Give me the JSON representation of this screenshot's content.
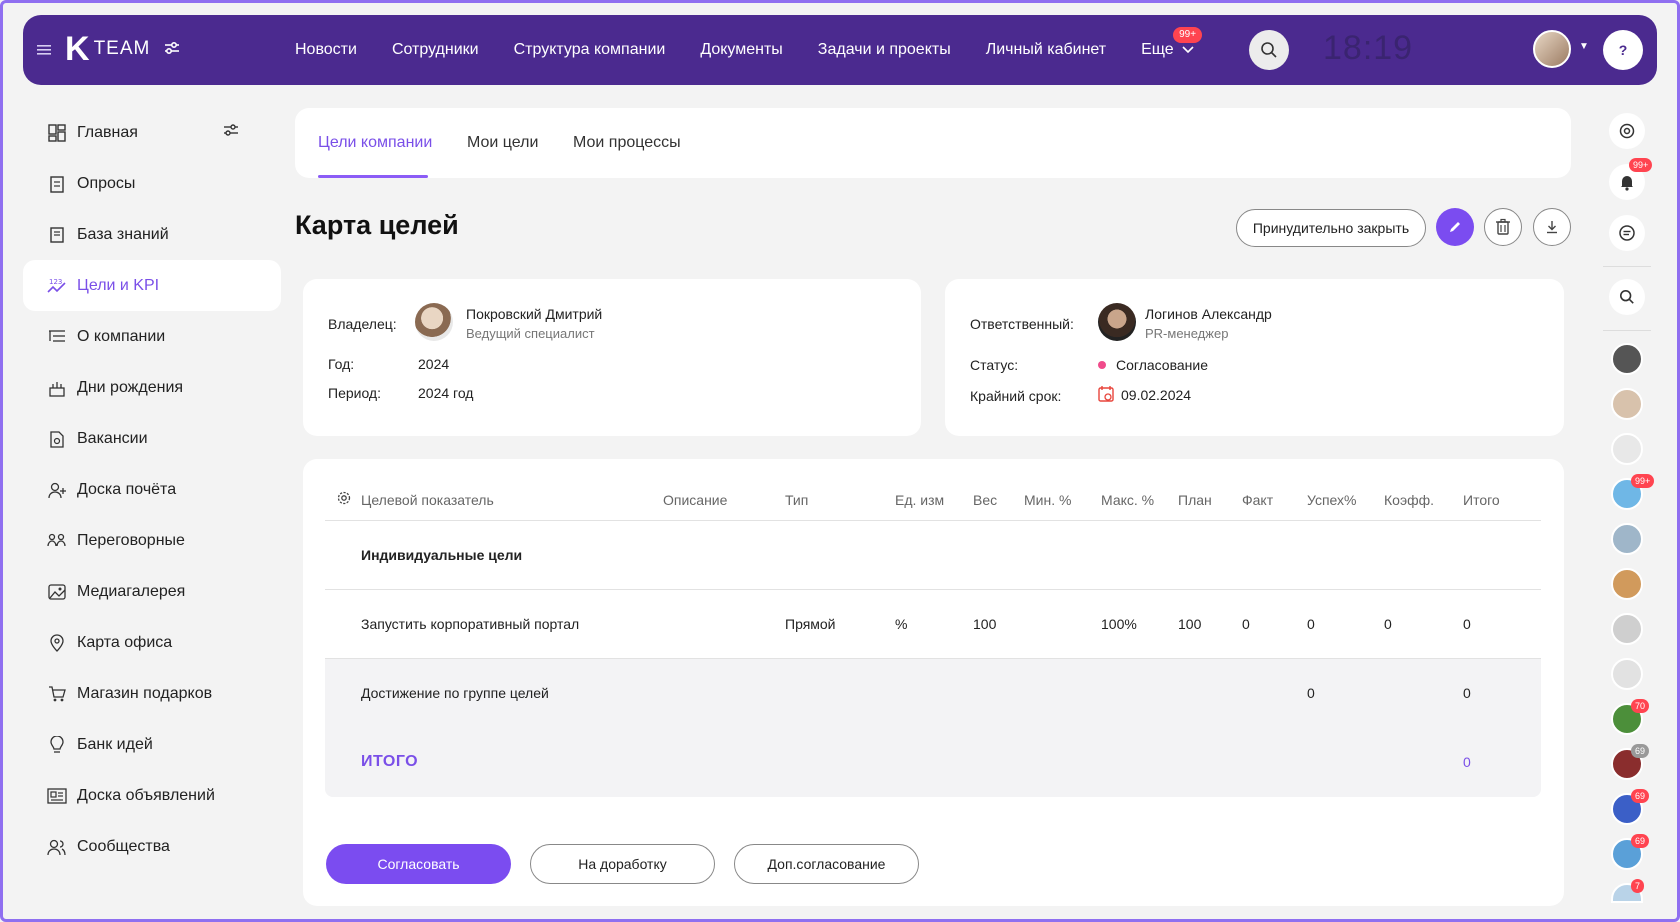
{
  "topbar": {
    "logo_k": "K",
    "logo_team": "TEAM",
    "nav": [
      "Новости",
      "Сотрудники",
      "Структура компании",
      "Документы",
      "Задачи и проекты",
      "Личный кабинет"
    ],
    "more_label": "Еще",
    "more_badge": "99+",
    "clock": "18:19"
  },
  "sidebar": {
    "items": [
      {
        "label": "Главная",
        "icon": "dashboard-icon"
      },
      {
        "label": "Опросы",
        "icon": "survey-icon"
      },
      {
        "label": "База знаний",
        "icon": "book-icon"
      },
      {
        "label": "Цели и KPI",
        "icon": "kpi-icon"
      },
      {
        "label": "О компании",
        "icon": "list-icon"
      },
      {
        "label": "Дни рождения",
        "icon": "cake-icon"
      },
      {
        "label": "Вакансии",
        "icon": "vacancy-icon"
      },
      {
        "label": "Доска почёта",
        "icon": "honor-icon"
      },
      {
        "label": "Переговорные",
        "icon": "meeting-icon"
      },
      {
        "label": "Медиагалерея",
        "icon": "gallery-icon"
      },
      {
        "label": "Карта офиса",
        "icon": "pin-icon"
      },
      {
        "label": "Магазин подарков",
        "icon": "cart-icon"
      },
      {
        "label": "Банк идей",
        "icon": "bulb-icon"
      },
      {
        "label": "Доска объявлений",
        "icon": "board-icon"
      },
      {
        "label": "Сообщества",
        "icon": "people-icon"
      }
    ],
    "active_index": 3
  },
  "tabs": [
    "Цели компании",
    "Мои цели",
    "Мои процессы"
  ],
  "page": {
    "title": "Карта целей",
    "force_close": "Принудительно закрыть"
  },
  "owner": {
    "owner_label": "Владелец:",
    "owner_name": "Покровский Дмитрий",
    "owner_role": "Ведущий специалист",
    "year_label": "Год:",
    "year": "2024",
    "period_label": "Период:",
    "period": "2024 год"
  },
  "responsible": {
    "resp_label": "Ответственный:",
    "resp_name": "Логинов Александр",
    "resp_role": "PR-менеджер",
    "status_label": "Статус:",
    "status": "Согласование",
    "status_color": "#f04b8b",
    "deadline_label": "Крайний срок:",
    "deadline": "09.02.2024"
  },
  "table": {
    "headers": {
      "goal": "Целевой показатель",
      "desc": "Описание",
      "type": "Тип",
      "unit": "Ед. изм",
      "weight": "Вес",
      "min": "Мин. %",
      "max": "Макс. %",
      "plan": "План",
      "fact": "Факт",
      "success": "Успех%",
      "coef": "Коэфф.",
      "total": "Итого"
    },
    "group": "Индивидуальные цели",
    "row": {
      "goal": "Запустить корпоративный портал",
      "type": "Прямой",
      "unit": "%",
      "weight": "100",
      "max": "100%",
      "plan": "100",
      "fact": "0",
      "success": "0",
      "coef": "0",
      "total": "0"
    },
    "group_achievement": {
      "label": "Достижение по группе целей",
      "success": "0",
      "total": "0"
    },
    "grand_total": {
      "label": "ИТОГО",
      "total": "0"
    }
  },
  "actions": {
    "approve": "Согласовать",
    "rework": "На доработку",
    "extra": "Доп.согласование"
  },
  "rightbar": {
    "notif_badge": "99+",
    "avatar_badges": [
      "",
      "",
      "",
      "99+",
      "",
      "",
      "",
      "",
      "70",
      "69",
      "69",
      "69",
      "7"
    ]
  },
  "accent_color": "#7b4cf0",
  "topbar_color": "#4b2a8f"
}
